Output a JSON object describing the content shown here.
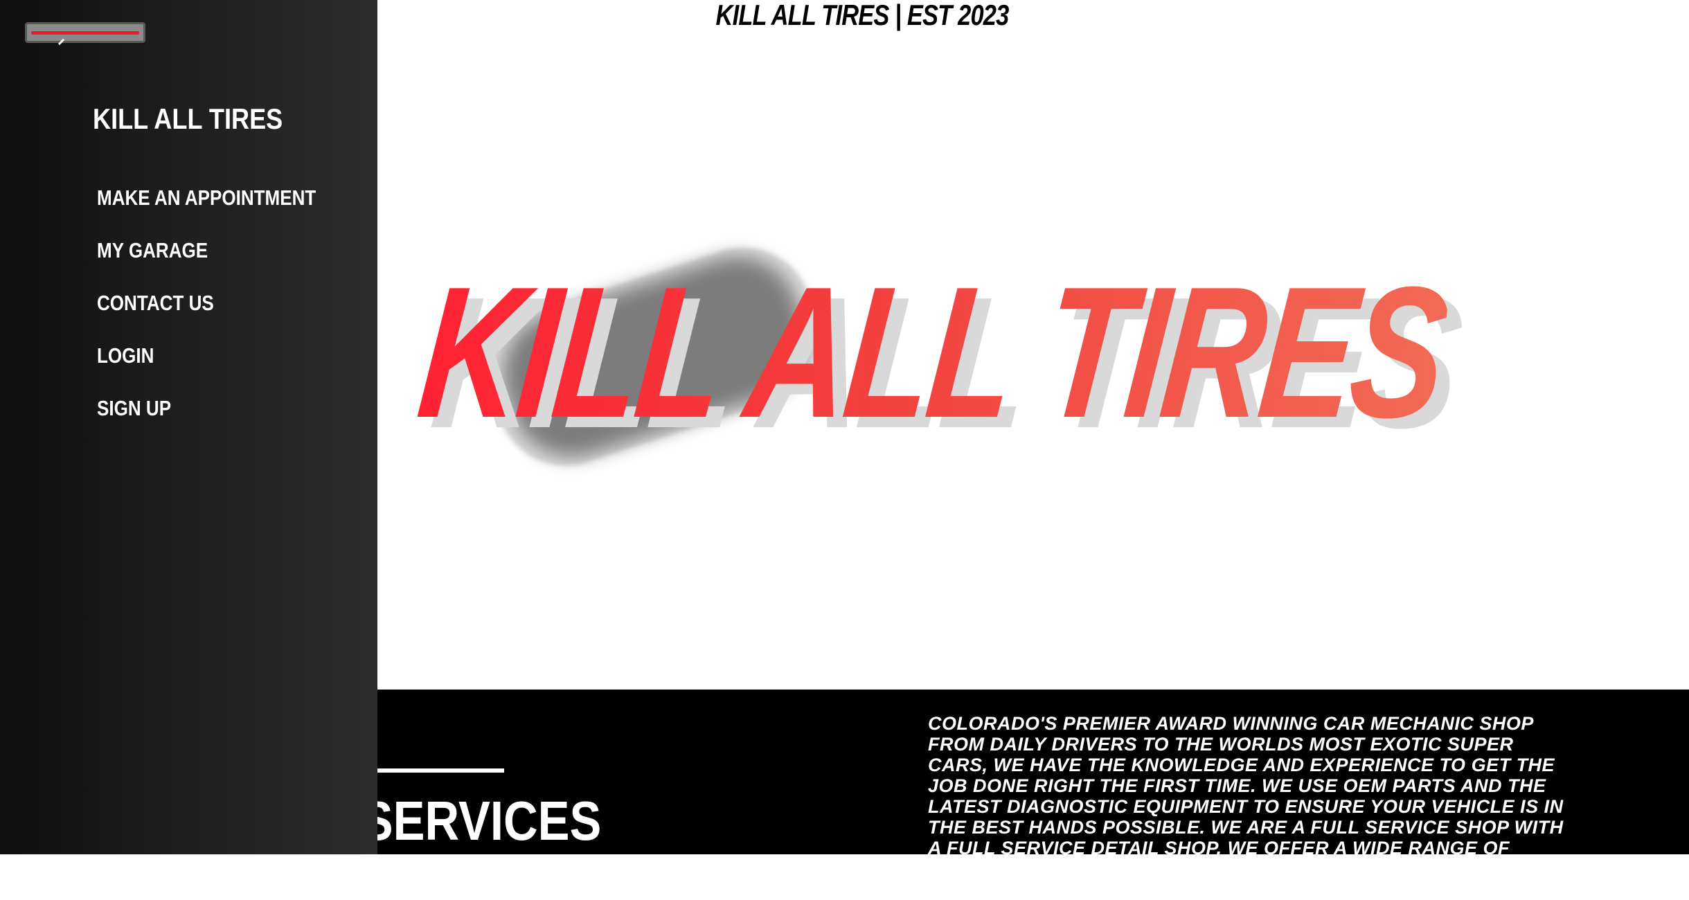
{
  "header": {
    "title": "KILL ALL TIRES | EST 2023"
  },
  "sidebar": {
    "toggle_icon": "menu-close-icon",
    "brand": "KILL ALL TIRES",
    "items": [
      {
        "label": "MAKE AN APPOINTMENT"
      },
      {
        "label": "MY GARAGE"
      },
      {
        "label": "CONTACT US"
      },
      {
        "label": "LOGIN"
      },
      {
        "label": "SIGN UP"
      }
    ]
  },
  "hero": {
    "wordmark": "KILL ALL TIRES"
  },
  "services": {
    "heading": "TIRES SERVICES",
    "description": "Colorado's premier award winning car mechanic shop from daily drivers to the worlds most exotic super cars, we have the knowledge and experience to get the job done right the first time. We use OEM parts and the latest diagnostic equipment to ensure your vehicle is in the best hands possible. We are a full service shop with a full service detail shop. We offer a wide range of services from oil changes to full engine rebuilds. We also offer a wide range of detailing services from"
  },
  "colors": {
    "accent": "#ff2233",
    "accent_end": "#f26a55",
    "sidebar_bg": "#1c1c1c",
    "band_bg": "#000000"
  }
}
